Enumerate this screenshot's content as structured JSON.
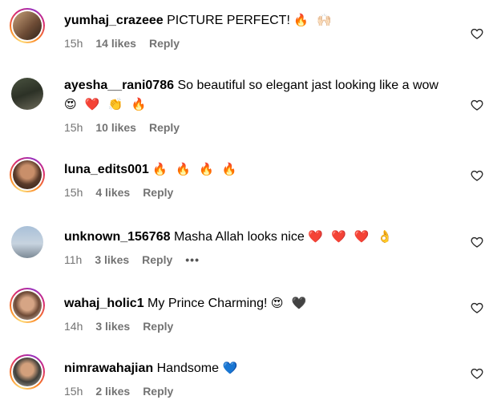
{
  "comments": [
    {
      "username": "yumhaj_crazeee",
      "text": "PICTURE PERFECT!",
      "emoji": "🔥 🙌🏻",
      "time": "15h",
      "likes": "14 likes",
      "reply": "Reply"
    },
    {
      "username": "ayesha__rani0786",
      "text": "So beautiful so elegant jast looking like a wow",
      "emoji": "😍 ❤️ 👏 🔥",
      "time": "15h",
      "likes": "10 likes",
      "reply": "Reply"
    },
    {
      "username": "luna_edits001",
      "text": "",
      "emoji": "🔥 🔥 🔥 🔥",
      "time": "15h",
      "likes": "4 likes",
      "reply": "Reply"
    },
    {
      "username": "unknown_156768",
      "text": "Masha Allah looks nice",
      "emoji": "❤️ ❤️ ❤️ 👌",
      "time": "11h",
      "likes": "3 likes",
      "reply": "Reply",
      "more": "•••"
    },
    {
      "username": "wahaj_holic1",
      "text": "My Prince Charming!",
      "emoji": "😍 🖤",
      "time": "14h",
      "likes": "3 likes",
      "reply": "Reply"
    },
    {
      "username": "nimrawahajian",
      "text": "Handsome",
      "emoji": "💙",
      "time": "15h",
      "likes": "2 likes",
      "reply": "Reply"
    }
  ]
}
